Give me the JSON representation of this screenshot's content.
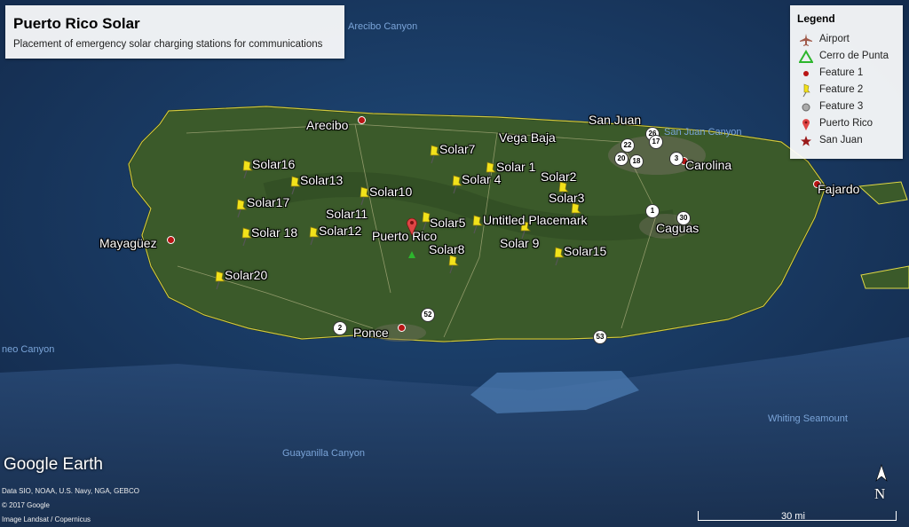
{
  "title": "Puerto Rico Solar",
  "subtitle": "Placement of emergency solar charging stations for communications",
  "legend": {
    "title": "Legend",
    "items": [
      {
        "label": "Airport",
        "icon": "airplane-icon",
        "color": "#a05a4a"
      },
      {
        "label": "Cerro de Punta",
        "icon": "triangle-icon",
        "color": "#2db62d"
      },
      {
        "label": "Feature 1",
        "icon": "red-dot-icon",
        "color": "#b91515"
      },
      {
        "label": "Feature 2",
        "icon": "yellow-pushpin-icon",
        "color": "#f2e21a"
      },
      {
        "label": "Feature 3",
        "icon": "gray-circle-icon",
        "color": "#8a8a8a"
      },
      {
        "label": "Puerto Rico",
        "icon": "red-pin-icon",
        "color": "#e04545"
      },
      {
        "label": "San Juan",
        "icon": "star-icon",
        "color": "#9a1a1a"
      }
    ]
  },
  "solar_labels": [
    "Solar16",
    "Solar13",
    "Solar10",
    "Solar17",
    "Solar11",
    "Solar 18",
    "Solar12",
    "Solar20",
    "Solar7",
    "Solar 1",
    "Solar 4",
    "Solar2",
    "Solar3",
    "Solar5",
    "Untitled Placemark",
    "Solar 9",
    "Solar8",
    "Solar15"
  ],
  "places": [
    "Arecibo",
    "Vega Baja",
    "San Juan",
    "Carolina",
    "Fajardo",
    "Caguas",
    "Mayagüez",
    "Ponce",
    "Puerto Rico"
  ],
  "ocean_labels": [
    "Arecibo Canyon",
    "San Juan Canyon",
    "Guayanilla Canyon",
    "Whiting Seamount",
    "neo Canyon"
  ],
  "routes": [
    "22",
    "26",
    "17",
    "20",
    "18",
    "3",
    "1",
    "30",
    "2",
    "52",
    "53"
  ],
  "attribution": {
    "brand": "Google Earth",
    "line1": "Data SIO, NOAA, U.S. Navy, NGA, GEBCO",
    "line2": "© 2017 Google",
    "line3": "Image Landsat / Copernicus"
  },
  "scale_label": "30 mi",
  "compass_label": "N",
  "colors": {
    "ocean": "#1c3a63",
    "land": "#3b5a2a",
    "border": "#e2da45",
    "pushpin": "#f2e21a"
  }
}
